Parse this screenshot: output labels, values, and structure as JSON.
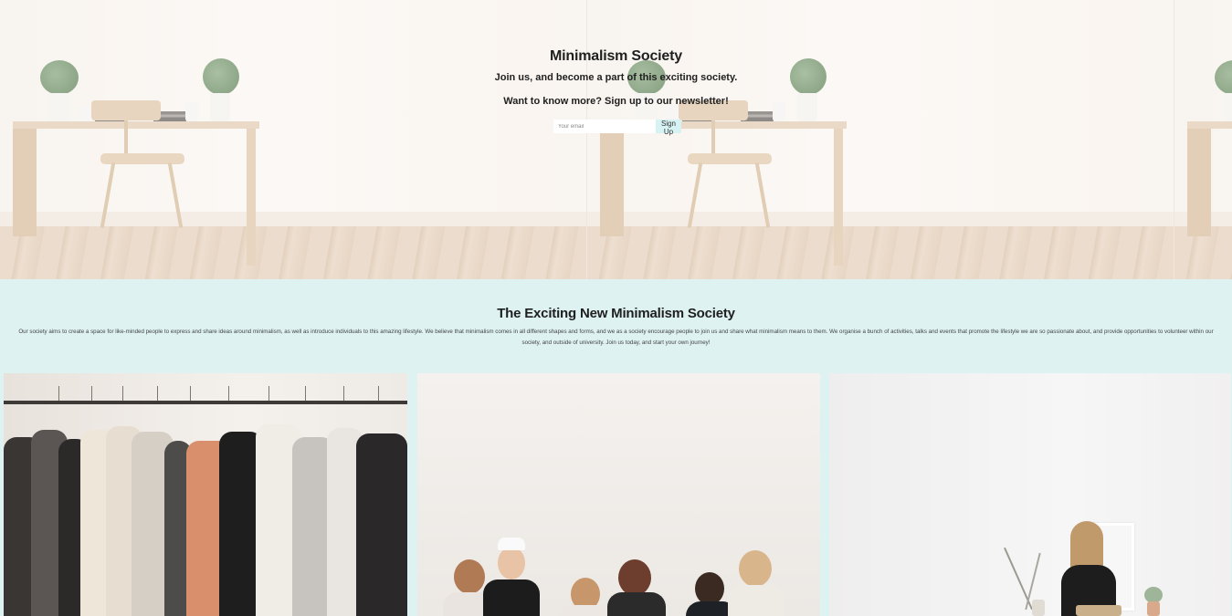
{
  "hero": {
    "title": "Minimalism Society",
    "subtitle": "Join us, and become a part of this exciting society.",
    "newsletter_prompt": "Want to know more? Sign up to our newsletter!",
    "email_placeholder": "Your email",
    "email_value": "",
    "signup_label": "Sign Up"
  },
  "about": {
    "title": "The Exciting New Minimalism Society",
    "body": "Our society aims to create a space for like-minded people to express and share ideas around minimalism, as well as introduce individuals to this amazing lifestyle. We believe that minimalism comes in all different shapes and forms, and we as a society encourage people to join us and share what minimalism means to them. We organise a bunch of activities, talks and events that promote the lifestyle we are so passionate about, and provide opportunities to volunteer within our society, and outside of university. Join us today, and start your own journey!"
  },
  "colors": {
    "about_background": "#def2f2",
    "signup_button": "#d7f2f2",
    "text_dark": "#1f1f1f"
  }
}
